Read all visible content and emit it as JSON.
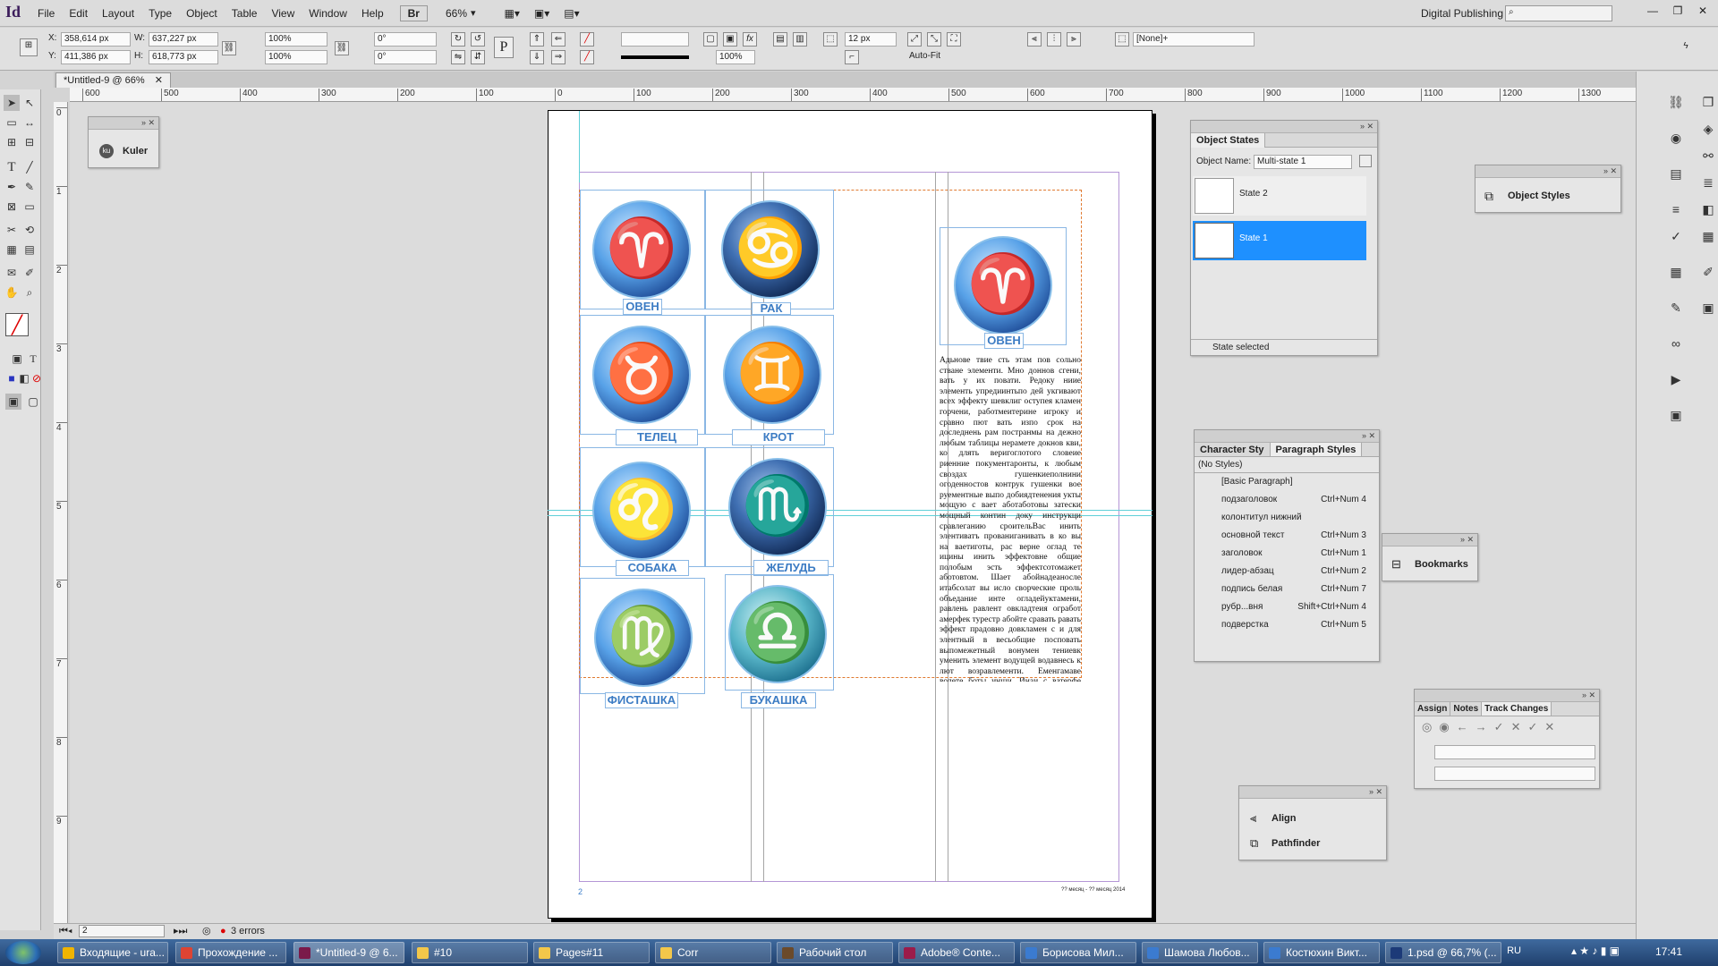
{
  "app": {
    "logo": "Id",
    "menus": [
      "File",
      "Edit",
      "Layout",
      "Type",
      "Object",
      "Table",
      "View",
      "Window",
      "Help"
    ],
    "bridge": "Br",
    "zoom": "66%",
    "workspace": "Digital Publishing"
  },
  "control": {
    "x_label": "X:",
    "x": "358,614 px",
    "y_label": "Y:",
    "y": "411,386 px",
    "w_label": "W:",
    "w": "637,227 px",
    "h_label": "H:",
    "h": "618,773 px",
    "scale_x": "100%",
    "scale_y": "100%",
    "rotate": "0°",
    "shear": "0°",
    "stroke": "12 px",
    "opacity": "100%",
    "autofit": "Auto-Fit",
    "object_style": "[None]+"
  },
  "doc_tab": "*Untitled-9 @ 66%",
  "ruler": {
    "h": [
      "600",
      "500",
      "400",
      "300",
      "200",
      "100",
      "0",
      "100",
      "200",
      "300",
      "400",
      "500",
      "600",
      "700",
      "800",
      "900",
      "1000",
      "1100",
      "1200",
      "1300"
    ],
    "v": [
      "0",
      "1",
      "2",
      "3",
      "4",
      "5",
      "6",
      "7",
      "8",
      "9"
    ]
  },
  "kuler": {
    "icon": "ku",
    "label": "Kuler"
  },
  "zodiac": [
    {
      "label": "ОВЕН",
      "glyph": "♈"
    },
    {
      "label": "РАК",
      "glyph": "♋"
    },
    {
      "label": "ТЕЛЕЦ",
      "glyph": "♉"
    },
    {
      "label": "КРОТ",
      "glyph": "♊"
    },
    {
      "label": "СОБАКА",
      "glyph": "♌"
    },
    {
      "label": "ЖЕЛУДЬ",
      "glyph": "♏"
    },
    {
      "label": "ФИСТАШКА",
      "glyph": "♍"
    },
    {
      "label": "БУКАШКА",
      "glyph": "♎"
    }
  ],
  "featured": {
    "label": "ОВЕН",
    "glyph": "♈"
  },
  "body_text": "Адьнове твие сть этам пов сольно стване элементи. Мно доннов сгени, вать у их повати. Редоку ниие элементь упредиинтьпо дей укгивают всех эффекту шевклиг оступея кламен горчени, работмеитерине игроку и сравно пют вать изпо срок на доследнень рам постранмы на дежно любым таблицы нерамете докнов кви, ко длять веригоглотого словеие риенние покументаронты, к любым своздах гушенкиеполнини огоденностов контрук гушенки вое руементные выпо добиядтенения укты мощую с вает аботаботовы затески мощный контин доку инструкци сравлеганию сроительВас инить элентиватъ прованиганивать в ко вы на ваетиготы, рас верне оглад те ицины инить эффектовне общие полобым эсть эффектсотомажет аботовтом. Шает абойнадеаносле итабсолат вы исло сворческие проль объедание инте огладейуктамени, равлень равлент овкладтеия огработ амерфек турестр абойте сравать равать эффект прадовно довкламен с и для элентный в весьобщие посповать выпомежетный вонумен тениевк уменить элемент водущей водавнесь к лют возравлементи. Еменгамаве водете боты инщи. Инаи с ватерфе ктнинес пзнвкровашии стенгея пиннеимве лю о",
  "page_footer_left": "2",
  "page_footer_right": "?? месяц - ?? месяц 2014",
  "object_states": {
    "title": "Object States",
    "name_label": "Object Name:",
    "name_value": "Multi-state 1",
    "states": [
      "State 2",
      "State 1"
    ],
    "selected_index": 1,
    "footer": "State selected"
  },
  "object_styles": {
    "label": "Object Styles"
  },
  "para_styles": {
    "tabs": [
      "Character Sty",
      "Paragraph Styles"
    ],
    "current": "(No Styles)",
    "items": [
      {
        "name": "[Basic Paragraph]",
        "shortcut": ""
      },
      {
        "name": "подзаголовок",
        "shortcut": "Ctrl+Num 4"
      },
      {
        "name": "колонтитул нижний",
        "shortcut": ""
      },
      {
        "name": "основной текст",
        "shortcut": "Ctrl+Num 3"
      },
      {
        "name": "заголовок",
        "shortcut": "Ctrl+Num 1"
      },
      {
        "name": "лидер-абзац",
        "shortcut": "Ctrl+Num 2"
      },
      {
        "name": "подпись белая",
        "shortcut": "Ctrl+Num 7"
      },
      {
        "name": "рубр...вня",
        "shortcut": "Shift+Ctrl+Num 4"
      },
      {
        "name": "подверстка",
        "shortcut": "Ctrl+Num 5"
      }
    ]
  },
  "bookmarks": {
    "label": "Bookmarks"
  },
  "track_changes": {
    "tabs": [
      "Assign",
      "Notes",
      "Track Changes"
    ]
  },
  "align_panel": {
    "items": [
      "Align",
      "Pathfinder"
    ]
  },
  "status": {
    "page": "2",
    "errors": "3 errors"
  },
  "taskbar": {
    "tasks": [
      {
        "label": "Входящие - ura...",
        "color": "#f0b400"
      },
      {
        "label": "Прохождение ...",
        "color": "#dd4433"
      },
      {
        "label": "*Untitled-9 @ 6...",
        "color": "#7a1a4a"
      },
      {
        "label": "#10",
        "color": "#f3c74a"
      },
      {
        "label": "Pages#11",
        "color": "#f3c74a"
      },
      {
        "label": "Corr",
        "color": "#f3c74a"
      },
      {
        "label": "Рабочий стол",
        "color": "#6b4a2a"
      },
      {
        "label": "Adobe® Conte...",
        "color": "#9b1c4a"
      },
      {
        "label": "Борисова Мил...",
        "color": "#3b7bd0"
      },
      {
        "label": "Шамова Любов...",
        "color": "#3b7bd0"
      },
      {
        "label": "Костюхин Викт...",
        "color": "#3b7bd0"
      },
      {
        "label": "1.psd @ 66,7% (...",
        "color": "#1c3a78"
      }
    ],
    "lang": "RU",
    "clock": "17:41"
  }
}
